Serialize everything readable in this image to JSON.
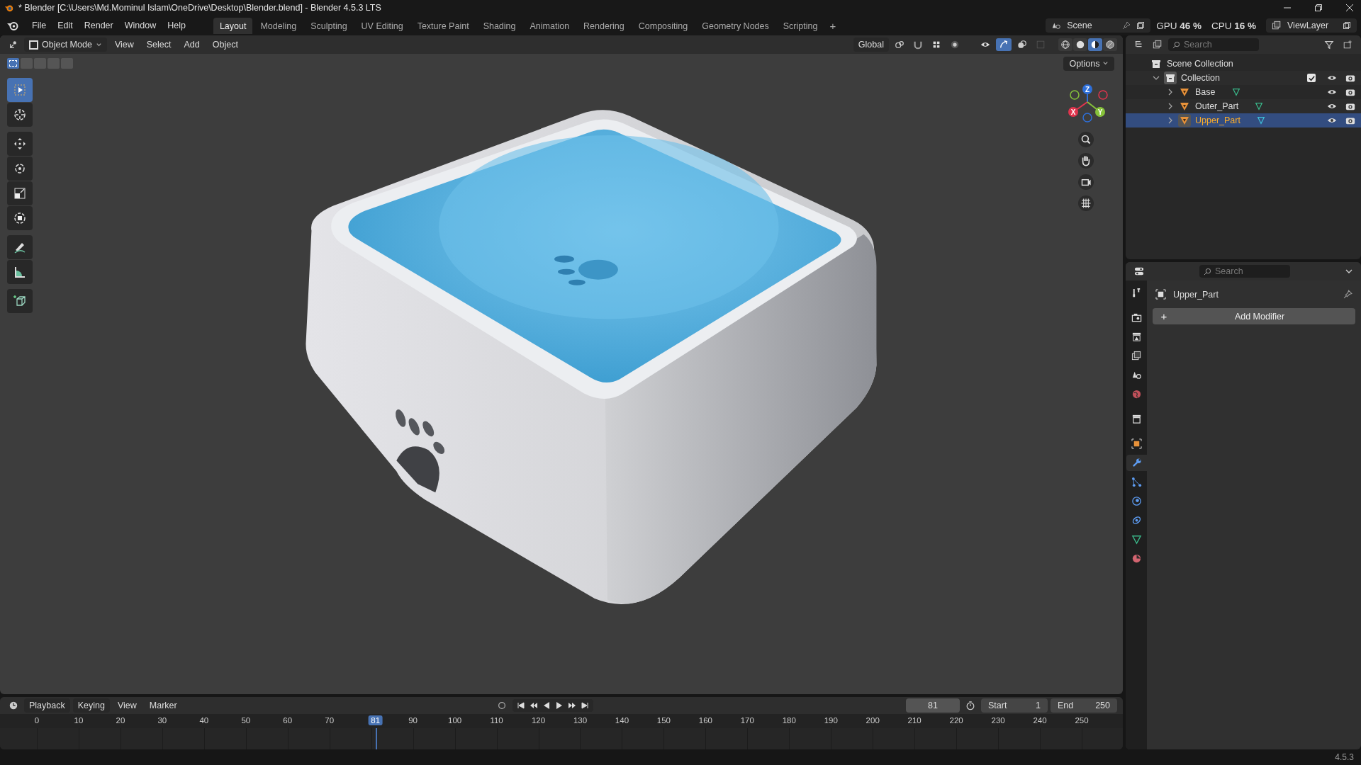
{
  "window": {
    "title": "* Blender [C:\\Users\\Md.Mominul Islam\\OneDrive\\Desktop\\Blender.blend] - Blender 4.5.3 LTS"
  },
  "menus": [
    "File",
    "Edit",
    "Render",
    "Window",
    "Help"
  ],
  "workspaces": [
    {
      "label": "Layout",
      "selected": true
    },
    {
      "label": "Modeling",
      "selected": false
    },
    {
      "label": "Sculpting",
      "selected": false
    },
    {
      "label": "UV Editing",
      "selected": false
    },
    {
      "label": "Texture Paint",
      "selected": false
    },
    {
      "label": "Shading",
      "selected": false
    },
    {
      "label": "Animation",
      "selected": false
    },
    {
      "label": "Rendering",
      "selected": false
    },
    {
      "label": "Compositing",
      "selected": false
    },
    {
      "label": "Geometry Nodes",
      "selected": false
    },
    {
      "label": "Scripting",
      "selected": false
    }
  ],
  "add_workspace": "+",
  "scene": "Scene",
  "view_layer": "ViewLayer",
  "stats": [
    {
      "label": "GPU",
      "value": "46 %"
    },
    {
      "label": "CPU",
      "value": "16 %"
    }
  ],
  "viewport": {
    "mode": "Object Mode",
    "menus": [
      "View",
      "Select",
      "Add",
      "Object"
    ],
    "orientation": "Global",
    "gizmos_on": true,
    "xray_on": false,
    "options": "Options",
    "select_modes": [
      {
        "selected": true
      },
      {
        "selected": false
      },
      {
        "selected": false
      },
      {
        "selected": false
      },
      {
        "selected": false
      }
    ],
    "shading": [
      {
        "kind": "wireframe",
        "selected": false
      },
      {
        "kind": "solid",
        "selected": false
      },
      {
        "kind": "material",
        "selected": true
      },
      {
        "kind": "rendered",
        "selected": false
      }
    ],
    "tools": [
      {
        "kind": "select",
        "selected": true
      },
      {
        "kind": "cursor",
        "selected": false
      },
      {
        "kind": "move",
        "selected": false
      },
      {
        "kind": "rotate",
        "selected": false
      },
      {
        "kind": "scale",
        "selected": false
      },
      {
        "kind": "transform",
        "selected": false
      },
      {
        "kind": "annotate",
        "selected": false
      },
      {
        "kind": "measure",
        "selected": false
      },
      {
        "kind": "add_cube",
        "selected": false
      }
    ],
    "axes": [
      {
        "label": "Z",
        "color": "#2e6fd9"
      },
      {
        "label": "X",
        "color": "#e0344d"
      },
      {
        "label": "Y",
        "color": "#86c23a"
      }
    ]
  },
  "outliner": {
    "search": {
      "placeholder": "Search"
    },
    "tree": [
      {
        "name": "Scene Collection",
        "kind": "scene_collection",
        "selected": false,
        "children": [
          {
            "name": "Collection",
            "kind": "collection",
            "expanded": true,
            "checked": true,
            "selected": false,
            "children": [
              {
                "name": "Base",
                "kind": "object",
                "expanded": false,
                "selected": false
              },
              {
                "name": "Outer_Part",
                "kind": "object",
                "expanded": false,
                "selected": false
              },
              {
                "name": "Upper_Part",
                "kind": "object",
                "expanded": false,
                "selected": true
              }
            ]
          }
        ]
      }
    ]
  },
  "properties": {
    "search": {
      "placeholder": "Search"
    },
    "tabs": [
      {
        "kind": "tool",
        "selected": false
      },
      {
        "kind": "render",
        "selected": false
      },
      {
        "kind": "output",
        "selected": false
      },
      {
        "kind": "view_layer",
        "selected": false
      },
      {
        "kind": "scene",
        "selected": false
      },
      {
        "kind": "world",
        "selected": false
      },
      {
        "kind": "collection",
        "selected": false
      },
      {
        "kind": "object",
        "selected": false
      },
      {
        "kind": "modifier",
        "selected": true
      },
      {
        "kind": "particles",
        "selected": false
      },
      {
        "kind": "physics",
        "selected": false
      },
      {
        "kind": "constraints",
        "selected": false
      },
      {
        "kind": "data",
        "selected": false
      },
      {
        "kind": "material",
        "selected": false
      }
    ],
    "object_name": "Upper_Part",
    "add_modifier": {
      "icon": "+",
      "label": "Add Modifier"
    }
  },
  "timeline": {
    "menus": [
      "Playback",
      "Keying",
      "View",
      "Marker"
    ],
    "current_frame": "81",
    "start": {
      "label": "Start",
      "value": "1"
    },
    "end": {
      "label": "End",
      "value": "250"
    },
    "ticks": [
      {
        "kind": "frame",
        "label": "0"
      },
      {
        "kind": "frame",
        "label": "10"
      },
      {
        "kind": "frame",
        "label": "20"
      },
      {
        "kind": "frame",
        "label": "30"
      },
      {
        "kind": "frame",
        "label": "40"
      },
      {
        "kind": "frame",
        "label": "50"
      },
      {
        "kind": "frame",
        "label": "60"
      },
      {
        "kind": "frame",
        "label": "70"
      },
      {
        "kind": "playhead",
        "label": "81"
      },
      {
        "kind": "frame",
        "label": "90"
      },
      {
        "kind": "frame",
        "label": "100"
      },
      {
        "kind": "frame",
        "label": "110"
      },
      {
        "kind": "frame",
        "label": "120"
      },
      {
        "kind": "frame",
        "label": "130"
      },
      {
        "kind": "frame",
        "label": "140"
      },
      {
        "kind": "frame",
        "label": "150"
      },
      {
        "kind": "frame",
        "label": "160"
      },
      {
        "kind": "frame",
        "label": "170"
      },
      {
        "kind": "frame",
        "label": "180"
      },
      {
        "kind": "frame",
        "label": "190"
      },
      {
        "kind": "frame",
        "label": "200"
      },
      {
        "kind": "frame",
        "label": "210"
      },
      {
        "kind": "frame",
        "label": "220"
      },
      {
        "kind": "frame",
        "label": "230"
      },
      {
        "kind": "frame",
        "label": "240"
      },
      {
        "kind": "frame",
        "label": "250"
      }
    ]
  },
  "status_bar": {
    "version": "4.5.3"
  }
}
